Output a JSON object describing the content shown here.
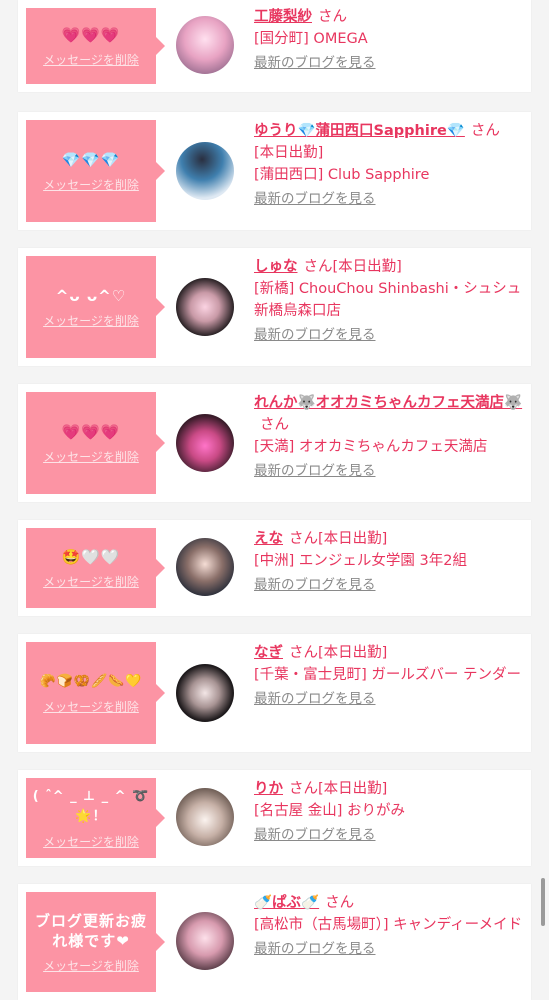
{
  "common": {
    "delete_label": "メッセージを削除",
    "san": "さん",
    "blog_label": "最新のブログを見る"
  },
  "colors": {
    "bubble": "#fc94a4",
    "accent": "#e8365f",
    "link_gray": "#8a8a8a"
  },
  "items": [
    {
      "message": "💗💗💗",
      "name": "工藤梨紗",
      "status": "",
      "shop": "[国分町] OMEGA"
    },
    {
      "message": "💎💎💎",
      "name": "ゆうり💎蒲田西口Sapphire💎",
      "status": "",
      "shop": "[本日出勤]\n[蒲田西口] Club Sapphire"
    },
    {
      "message": "^ᴗ ᴗ^♡",
      "name": "しゅな",
      "status": "[本日出勤]",
      "shop": "[新橋] ChouChou Shinbashi・シュシュ新橋烏森口店"
    },
    {
      "message": "💗💗💗",
      "name": "れんか🐺オオカミちゃんカフェ天満店🐺",
      "status": "",
      "shop": "[天満] オオカミちゃんカフェ天満店"
    },
    {
      "message": "🤩🤍🤍",
      "name": "えな",
      "status": "[本日出勤]",
      "shop": "[中洲] エンジェル女学園 3年2組"
    },
    {
      "message": "🥐🍞🥨🥖🌭💛",
      "name": "なぎ",
      "status": "[本日出勤]",
      "shop": "[千葉・富士見町] ガールズバー テンダー"
    },
    {
      "message": "( ˆ^ _ ⊥ _ ^ ➰🌟！",
      "name": "りか",
      "status": "[本日出勤]",
      "shop": "[名古屋 金山] おりがみ"
    },
    {
      "message": "ブログ更新お疲れ様です❤",
      "name": "🍼ぱぶ🍼",
      "status": "",
      "shop": "[高松市（古馬場町）] キャンディーメイド"
    }
  ]
}
